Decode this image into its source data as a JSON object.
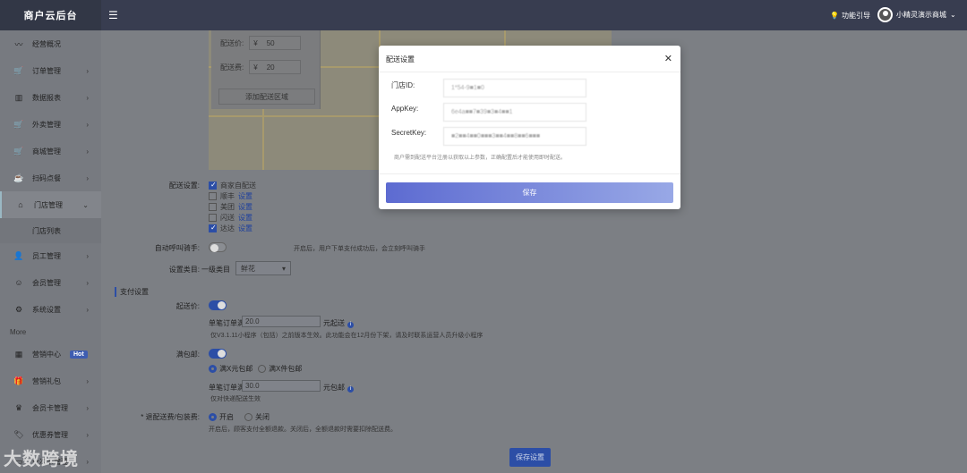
{
  "header": {
    "brand": "商户云后台",
    "menu_icon": "menu-icon",
    "guide": "功能引导",
    "user": "小精灵演示商城"
  },
  "sidebar": {
    "items": [
      {
        "label": "经营概况",
        "icon": "chart-icon"
      },
      {
        "label": "订单管理",
        "icon": "cart-icon"
      },
      {
        "label": "数据报表",
        "icon": "bar-icon"
      },
      {
        "label": "外卖管理",
        "icon": "cart-icon"
      },
      {
        "label": "商城管理",
        "icon": "cart-icon"
      },
      {
        "label": "扫码点餐",
        "icon": "cup-icon"
      },
      {
        "label": "门店管理",
        "icon": "home-icon"
      }
    ],
    "sub_item": "门店列表",
    "items2": [
      {
        "label": "员工管理",
        "icon": "user-icon"
      },
      {
        "label": "会员管理",
        "icon": "smile-icon"
      },
      {
        "label": "系统设置",
        "icon": "gear-icon"
      }
    ],
    "more": "More",
    "items3": [
      {
        "label": "营销中心",
        "icon": "grid-icon",
        "badge": "Hot"
      },
      {
        "label": "营销礼包",
        "icon": "gift-icon"
      },
      {
        "label": "会员卡管理",
        "icon": "crown-icon"
      },
      {
        "label": "优惠券管理",
        "icon": "tag-icon"
      },
      {
        "label": "计次卡管理",
        "icon": "card-icon"
      }
    ]
  },
  "zone": {
    "price_label": "配送价:",
    "price": "50",
    "fee_label": "配送费:",
    "fee": "20",
    "currency": "¥",
    "add": "添加配送区域"
  },
  "delivery": {
    "label": "配送设置:",
    "options": [
      {
        "name": "商家自配送",
        "checked": true,
        "link": ""
      },
      {
        "name": "顺丰",
        "checked": false,
        "link": "设置"
      },
      {
        "name": "美团",
        "checked": false,
        "link": "设置"
      },
      {
        "name": "闪送",
        "checked": false,
        "link": "设置"
      },
      {
        "name": "达达",
        "checked": true,
        "link": "设置"
      }
    ]
  },
  "auto_call": {
    "label": "自动呼叫骑手:",
    "hint": "开启后，用户下单支付成功后，会立刻呼叫骑手"
  },
  "category": {
    "label": "设置类目:",
    "sub": "一级类目",
    "value": "鲜花"
  },
  "pay": {
    "section": "支付设置"
  },
  "min_order": {
    "label": "起送价:",
    "prefix": "单笔订单满",
    "value": "20.0",
    "suffix": "元起送",
    "hint": "仅V3.1.11小程序（包括）之前版本生效。此功能会在12月份下架，请及时联系运营人员升级小程序"
  },
  "free_ship": {
    "label": "满包邮:",
    "opt1": "满X元包邮",
    "opt2": "满X件包邮",
    "prefix": "单笔订单满",
    "value": "30.0",
    "suffix": "元包邮",
    "hint": "仅对快递配送生效"
  },
  "refund": {
    "label": "* 退配送费/包装费:",
    "on": "开启",
    "off": "关闭",
    "hint": "开启后，顾客支付全额退款。关闭后，全额退款时需要扣除配送费。"
  },
  "save_page": "保存设置",
  "watermark": "大数跨境",
  "modal": {
    "title": "配送设置",
    "fields": [
      {
        "label": "门店ID:",
        "value": "1*54-9■1■0"
      },
      {
        "label": "AppKey:",
        "value": "6e4a■■7■39■3■4■■1"
      },
      {
        "label": "SecretKey:",
        "value": "■2■■4■■0■■■3■■4■■8■■6■■■"
      }
    ],
    "tip": "商户需到配送平台注册以获取以上参数，正确配置后才能使用即时配送。",
    "save": "保存"
  },
  "colors": {
    "accent": "#2c4ea6",
    "topbar": "#383d50",
    "modal_button": "#6f7fd9"
  }
}
